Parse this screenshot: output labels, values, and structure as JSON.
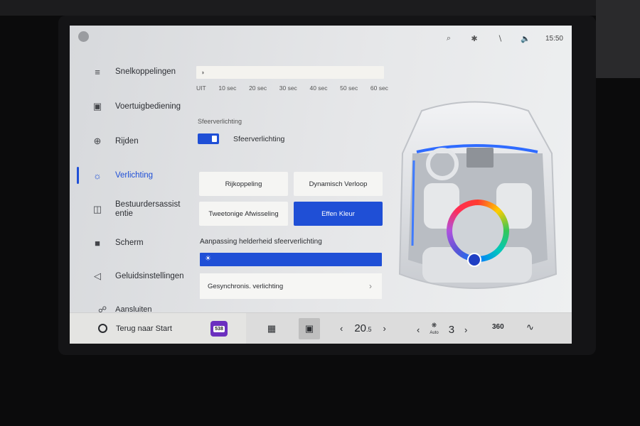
{
  "status_bar": {
    "time": "15:50",
    "icons": [
      "profile-icon",
      "wifi-icon",
      "bluetooth-icon",
      "signal-icon",
      "volume-icon"
    ]
  },
  "sidebar": {
    "items": [
      {
        "label": "Snelkoppelingen",
        "icon": "sliders-icon"
      },
      {
        "label": "Voertuigbediening",
        "icon": "car-icon"
      },
      {
        "label": "Rijden",
        "icon": "steering-wheel-icon"
      },
      {
        "label": "Verlichting",
        "icon": "light-icon",
        "active": true
      },
      {
        "label": "Bestuurdersassist entie",
        "icon": "driver-assist-icon"
      },
      {
        "label": "Scherm",
        "icon": "screen-icon"
      },
      {
        "label": "Geluidsinstellingen",
        "icon": "speaker-icon"
      },
      {
        "label": "Aansluiten",
        "icon": "link-icon"
      }
    ]
  },
  "timer": {
    "ticks": [
      "UIT",
      "10 sec",
      "20 sec",
      "30 sec",
      "40 sec",
      "50 sec",
      "60 sec"
    ]
  },
  "ambient": {
    "section_label": "Sfeerverlichting",
    "toggle_label": "Sfeerverlichting",
    "toggle_on": true,
    "modes": [
      {
        "label": "Rijkoppeling",
        "selected": false
      },
      {
        "label": "Dynamisch Verloop",
        "selected": false
      },
      {
        "label": "Tweetonige Afwisseling",
        "selected": false
      },
      {
        "label": "Effen Kleur",
        "selected": true
      }
    ],
    "brightness_label": "Aanpassing helderheid sfeerverlichting",
    "brightness_level": 1.0,
    "sync_label": "Gesynchronis. verlichting"
  },
  "dock": {
    "home_label": "Terug naar Start",
    "app_badge": "538",
    "temperature": "20",
    "temperature_decimal": ".5",
    "fan_level": "3",
    "fan_label": "Auto",
    "camera_label": "360",
    "accent_color": "#1f4fd6"
  }
}
